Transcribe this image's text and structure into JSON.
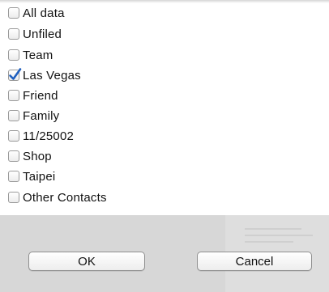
{
  "groups": [
    {
      "label": "All data",
      "checked": false
    },
    {
      "label": "Unfiled",
      "checked": false
    },
    {
      "label": "Team",
      "checked": false
    },
    {
      "label": "Las Vegas",
      "checked": true
    },
    {
      "label": "Friend",
      "checked": false
    },
    {
      "label": "Family",
      "checked": false
    },
    {
      "label": "11/25002",
      "checked": false
    },
    {
      "label": "Shop",
      "checked": false
    },
    {
      "label": "Taipei",
      "checked": false
    },
    {
      "label": "Other Contacts",
      "checked": false
    }
  ],
  "buttons": {
    "ok_label": "OK",
    "cancel_label": "Cancel"
  },
  "colors": {
    "checkmark": "#1f5fbf",
    "footer": "#d7d7d7"
  }
}
